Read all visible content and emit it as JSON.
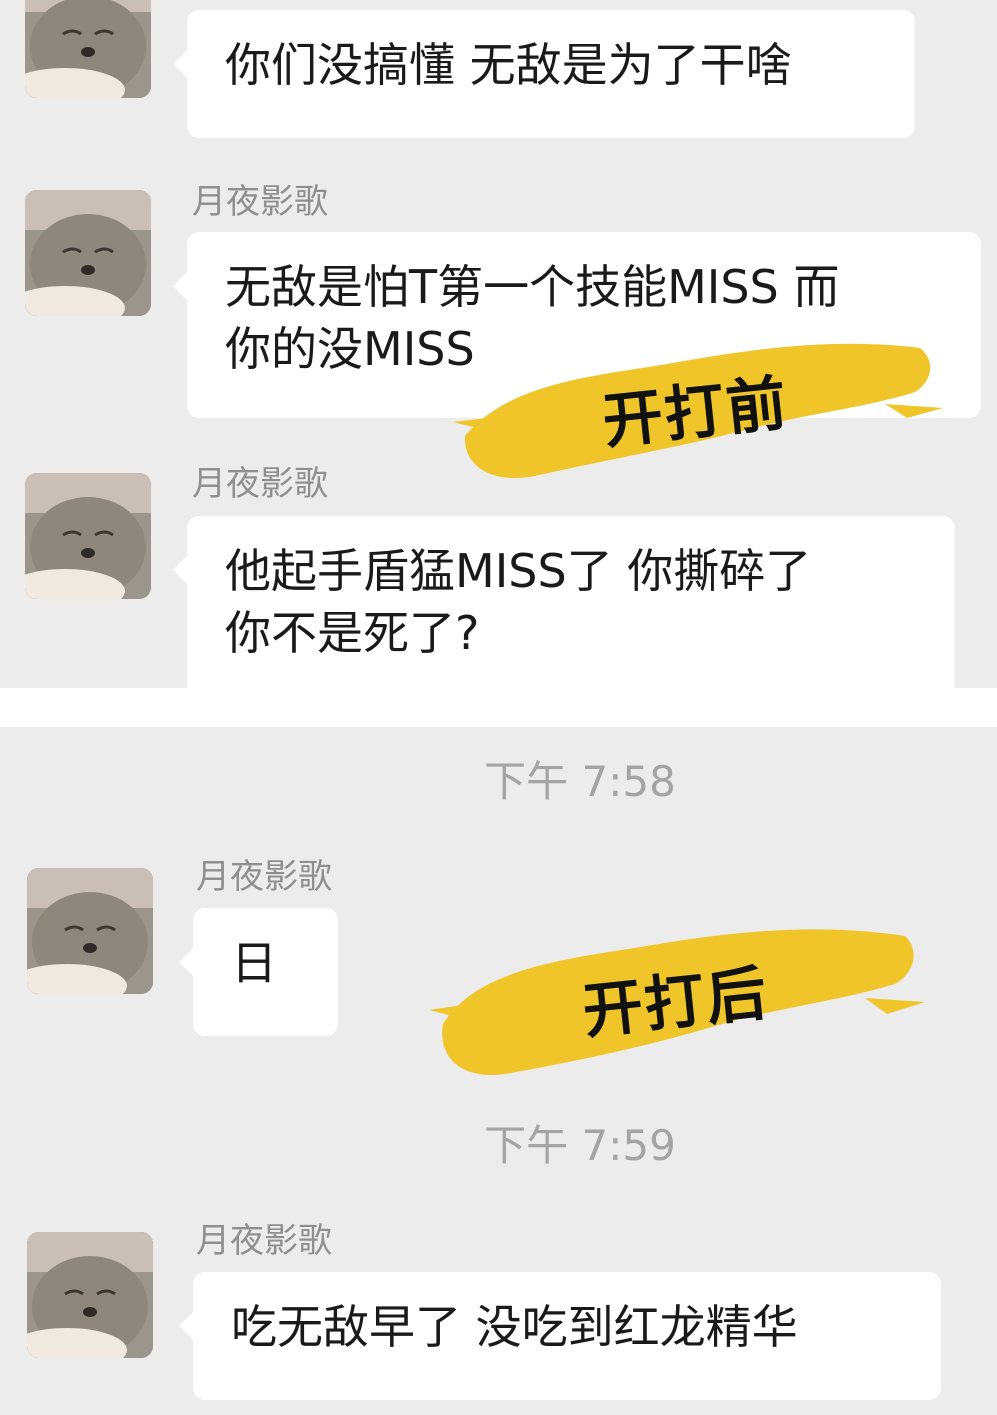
{
  "sender_name": "月夜影歌",
  "messages_top": [
    {
      "lines": [
        "你们没搞懂 无敌是为了干啥"
      ]
    },
    {
      "lines": [
        "无敌是怕T第一个技能MISS 而",
        "你的没MISS"
      ]
    },
    {
      "lines": [
        "他起手盾猛MISS了 你撕碎了",
        "你不是死了?"
      ]
    }
  ],
  "timestamps": [
    "下午 7:58",
    "下午 7:59"
  ],
  "messages_bottom": [
    {
      "lines": [
        "日"
      ]
    },
    {
      "lines": [
        "吃无敌早了 没吃到红龙精华"
      ]
    }
  ],
  "stickers": {
    "before": "开打前",
    "after": "开打后"
  },
  "colors": {
    "background": "#ececec",
    "bubble": "#ffffff",
    "sticker_yellow": "#f0c52a"
  }
}
